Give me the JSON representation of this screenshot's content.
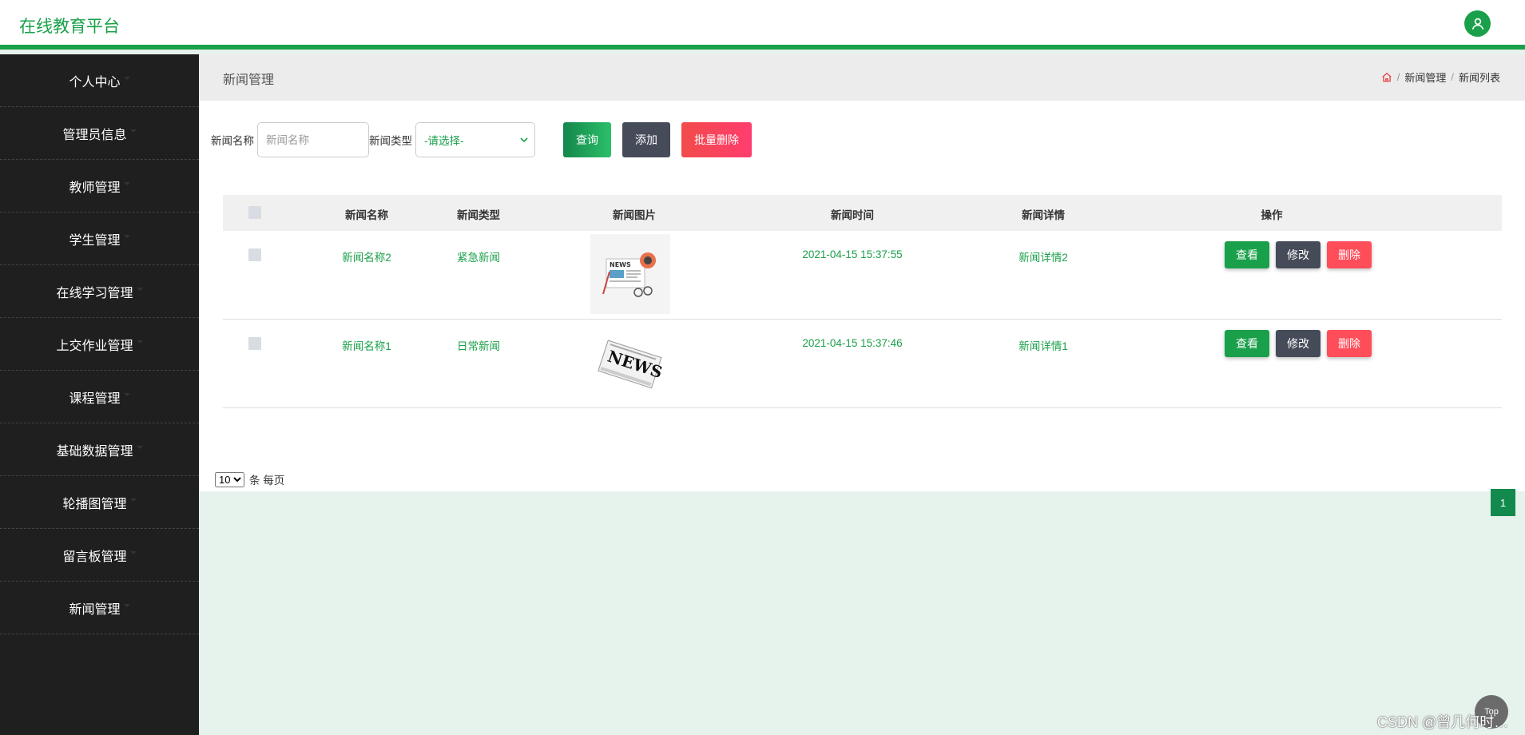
{
  "header": {
    "brand": "在线教育平台",
    "avatar_icon": "user-icon"
  },
  "sidebar": {
    "items": [
      {
        "label": "个人中心"
      },
      {
        "label": "管理员信息"
      },
      {
        "label": "教师管理"
      },
      {
        "label": "学生管理"
      },
      {
        "label": "在线学习管理"
      },
      {
        "label": "上交作业管理"
      },
      {
        "label": "课程管理"
      },
      {
        "label": "基础数据管理"
      },
      {
        "label": "轮播图管理"
      },
      {
        "label": "留言板管理"
      },
      {
        "label": "新闻管理"
      }
    ]
  },
  "page": {
    "title": "新闻管理",
    "breadcrumb": {
      "home_icon": "home-icon",
      "sep": "/",
      "level1": "新闻管理",
      "level2": "新闻列表"
    }
  },
  "search": {
    "name_label": "新闻名称",
    "name_placeholder": "新闻名称",
    "type_label": "新闻类型",
    "type_selected": "-请选择-",
    "query_label": "查询",
    "add_label": "添加",
    "batch_delete_label": "批量删除"
  },
  "table": {
    "headers": [
      "新闻名称",
      "新闻类型",
      "新闻图片",
      "新闻时间",
      "新闻详情",
      "操作"
    ],
    "rows": [
      {
        "name": "新闻名称2",
        "type": "紧急新闻",
        "image": "news-illustration",
        "time": "2021-04-15 15:37:55",
        "detail": "新闻详情2"
      },
      {
        "name": "新闻名称1",
        "type": "日常新闻",
        "image": "newspaper-illustration",
        "time": "2021-04-15 15:37:46",
        "detail": "新闻详情1"
      }
    ],
    "actions": {
      "view": "查看",
      "edit": "修改",
      "delete": "删除"
    }
  },
  "pagination": {
    "page_size": "10",
    "page_size_suffix": "条 每页",
    "current_page": "1"
  },
  "footer": {
    "top_label": "Top",
    "watermark": "CSDN @曾几何时…"
  },
  "colors": {
    "accent": "#1aa04a",
    "sidebar_bg": "#1f1f1f",
    "danger": "#ff4d5a",
    "dark_button": "#464b59"
  }
}
